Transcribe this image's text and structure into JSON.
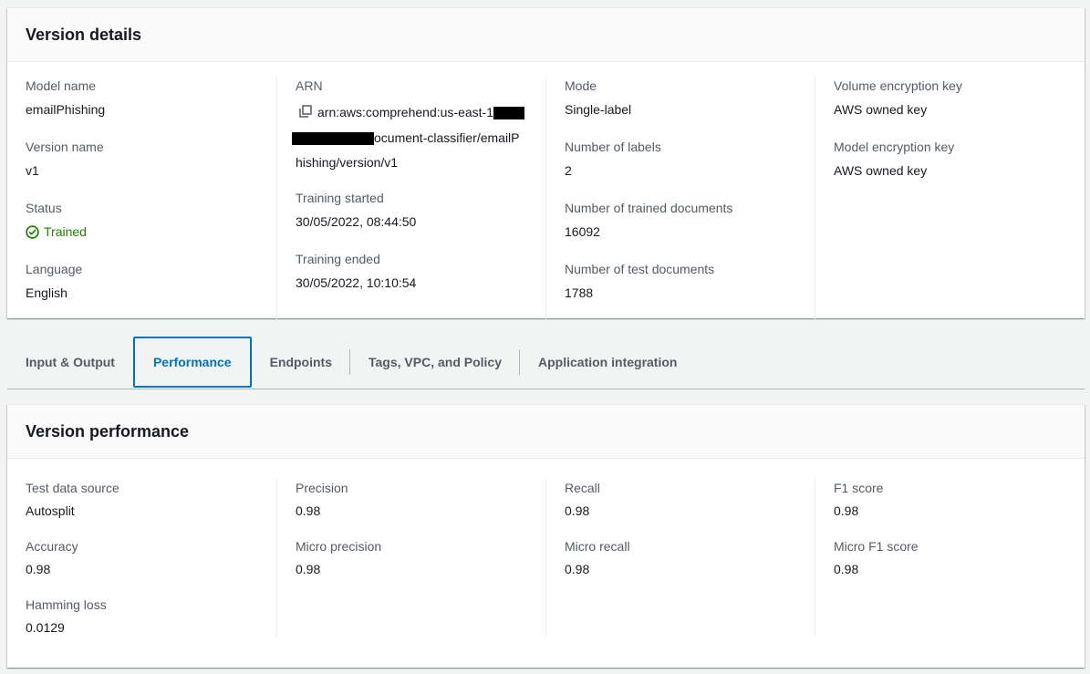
{
  "version_details": {
    "title": "Version details",
    "model_name": {
      "label": "Model name",
      "value": "emailPhishing"
    },
    "version_name": {
      "label": "Version name",
      "value": "v1"
    },
    "status": {
      "label": "Status",
      "value": "Trained",
      "color": "#1d8102",
      "icon": "check-circle-icon"
    },
    "language": {
      "label": "Language",
      "value": "English"
    },
    "arn": {
      "label": "ARN",
      "value_start": "arn:aws:comprehend:us-east-1",
      "value_mid": "ocument-classifier/emailP",
      "value_end": "hishing/version/v1",
      "icon": "copy-icon"
    },
    "training_started": {
      "label": "Training started",
      "value": "30/05/2022, 08:44:50"
    },
    "training_ended": {
      "label": "Training ended",
      "value": "30/05/2022, 10:10:54"
    },
    "mode": {
      "label": "Mode",
      "value": "Single-label"
    },
    "number_of_labels": {
      "label": "Number of labels",
      "value": "2"
    },
    "trained_documents": {
      "label": "Number of trained documents",
      "value": "16092"
    },
    "test_documents": {
      "label": "Number of test documents",
      "value": "1788"
    },
    "volume_key": {
      "label": "Volume encryption key",
      "value": "AWS owned key"
    },
    "model_key": {
      "label": "Model encryption key",
      "value": "AWS owned key"
    }
  },
  "tabs": [
    {
      "label": "Input & Output"
    },
    {
      "label": "Performance",
      "active": true
    },
    {
      "label": "Endpoints"
    },
    {
      "label": "Tags, VPC, and Policy"
    },
    {
      "label": "Application integration"
    }
  ],
  "performance": {
    "title": "Version performance",
    "test_data_source": {
      "label": "Test data source",
      "value": "Autosplit"
    },
    "accuracy": {
      "label": "Accuracy",
      "value": "0.98"
    },
    "hamming_loss": {
      "label": "Hamming loss",
      "value": "0.0129"
    },
    "precision": {
      "label": "Precision",
      "value": "0.98"
    },
    "micro_precision": {
      "label": "Micro precision",
      "value": "0.98"
    },
    "recall": {
      "label": "Recall",
      "value": "0.98"
    },
    "micro_recall": {
      "label": "Micro recall",
      "value": "0.98"
    },
    "f1_score": {
      "label": "F1 score",
      "value": "0.98"
    },
    "micro_f1_score": {
      "label": "Micro F1 score",
      "value": "0.98"
    }
  },
  "colors": {
    "accent": "#0073bb",
    "success": "#1d8102"
  }
}
